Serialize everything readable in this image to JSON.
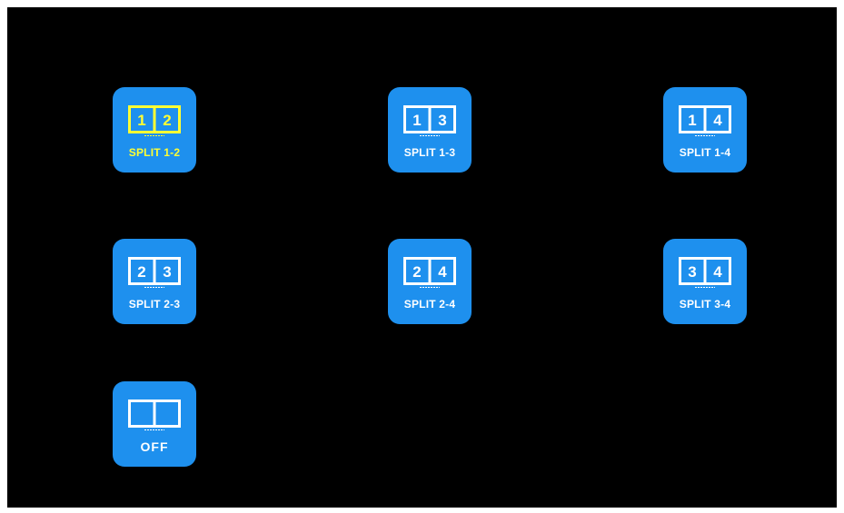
{
  "colors": {
    "tile": "#1e90ee",
    "selected_highlight": "#ffff33",
    "icon_normal": "#ffffff",
    "background": "#000000"
  },
  "tiles": [
    {
      "label": "SPLIT 1-2",
      "left_num": "1",
      "right_num": "2",
      "selected": true
    },
    {
      "label": "SPLIT 1-3",
      "left_num": "1",
      "right_num": "3",
      "selected": false
    },
    {
      "label": "SPLIT 1-4",
      "left_num": "1",
      "right_num": "4",
      "selected": false
    },
    {
      "label": "SPLIT 2-3",
      "left_num": "2",
      "right_num": "3",
      "selected": false
    },
    {
      "label": "SPLIT 2-4",
      "left_num": "2",
      "right_num": "4",
      "selected": false
    },
    {
      "label": "SPLIT 3-4",
      "left_num": "3",
      "right_num": "4",
      "selected": false
    },
    {
      "label": "OFF",
      "left_num": "",
      "right_num": "",
      "selected": false
    }
  ]
}
